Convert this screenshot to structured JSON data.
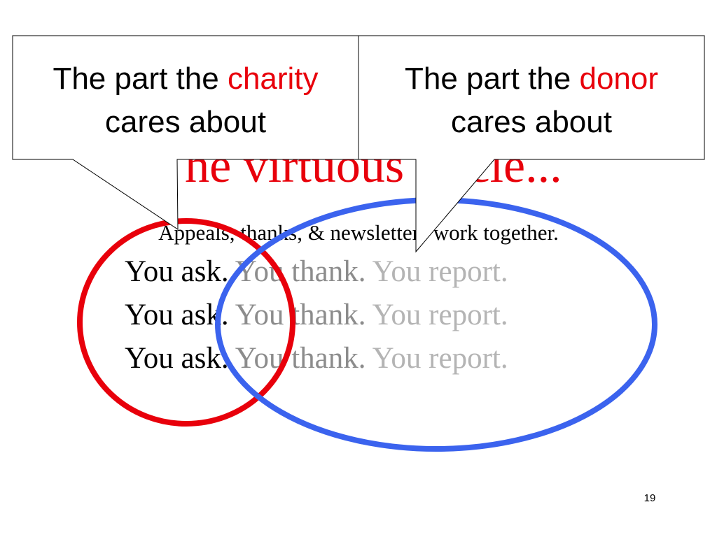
{
  "slide": {
    "title": "The virtuous circle...",
    "subtitle": "Appeals, thanks, & newsletters work together.",
    "cycle_lines": [
      {
        "ask": "You ask.",
        "thank": "You thank.",
        "report": "You report."
      },
      {
        "ask": "You ask.",
        "thank": "You thank.",
        "report": "You report."
      },
      {
        "ask": "You ask.",
        "thank": "You thank.",
        "report": "You report."
      }
    ],
    "callouts": {
      "charity": {
        "prefix": "The part the ",
        "highlight": "charity",
        "line2": "cares about"
      },
      "donor": {
        "prefix": "The part the ",
        "highlight": "donor",
        "line2": "cares about"
      }
    },
    "page_number": "19"
  },
  "colors": {
    "title_red": "#e8000b",
    "charity_circle": "#e8000b",
    "donor_circle": "#3b63ee",
    "thank_gray": "#8c8c8c",
    "report_gray": "#b4b4b4"
  }
}
